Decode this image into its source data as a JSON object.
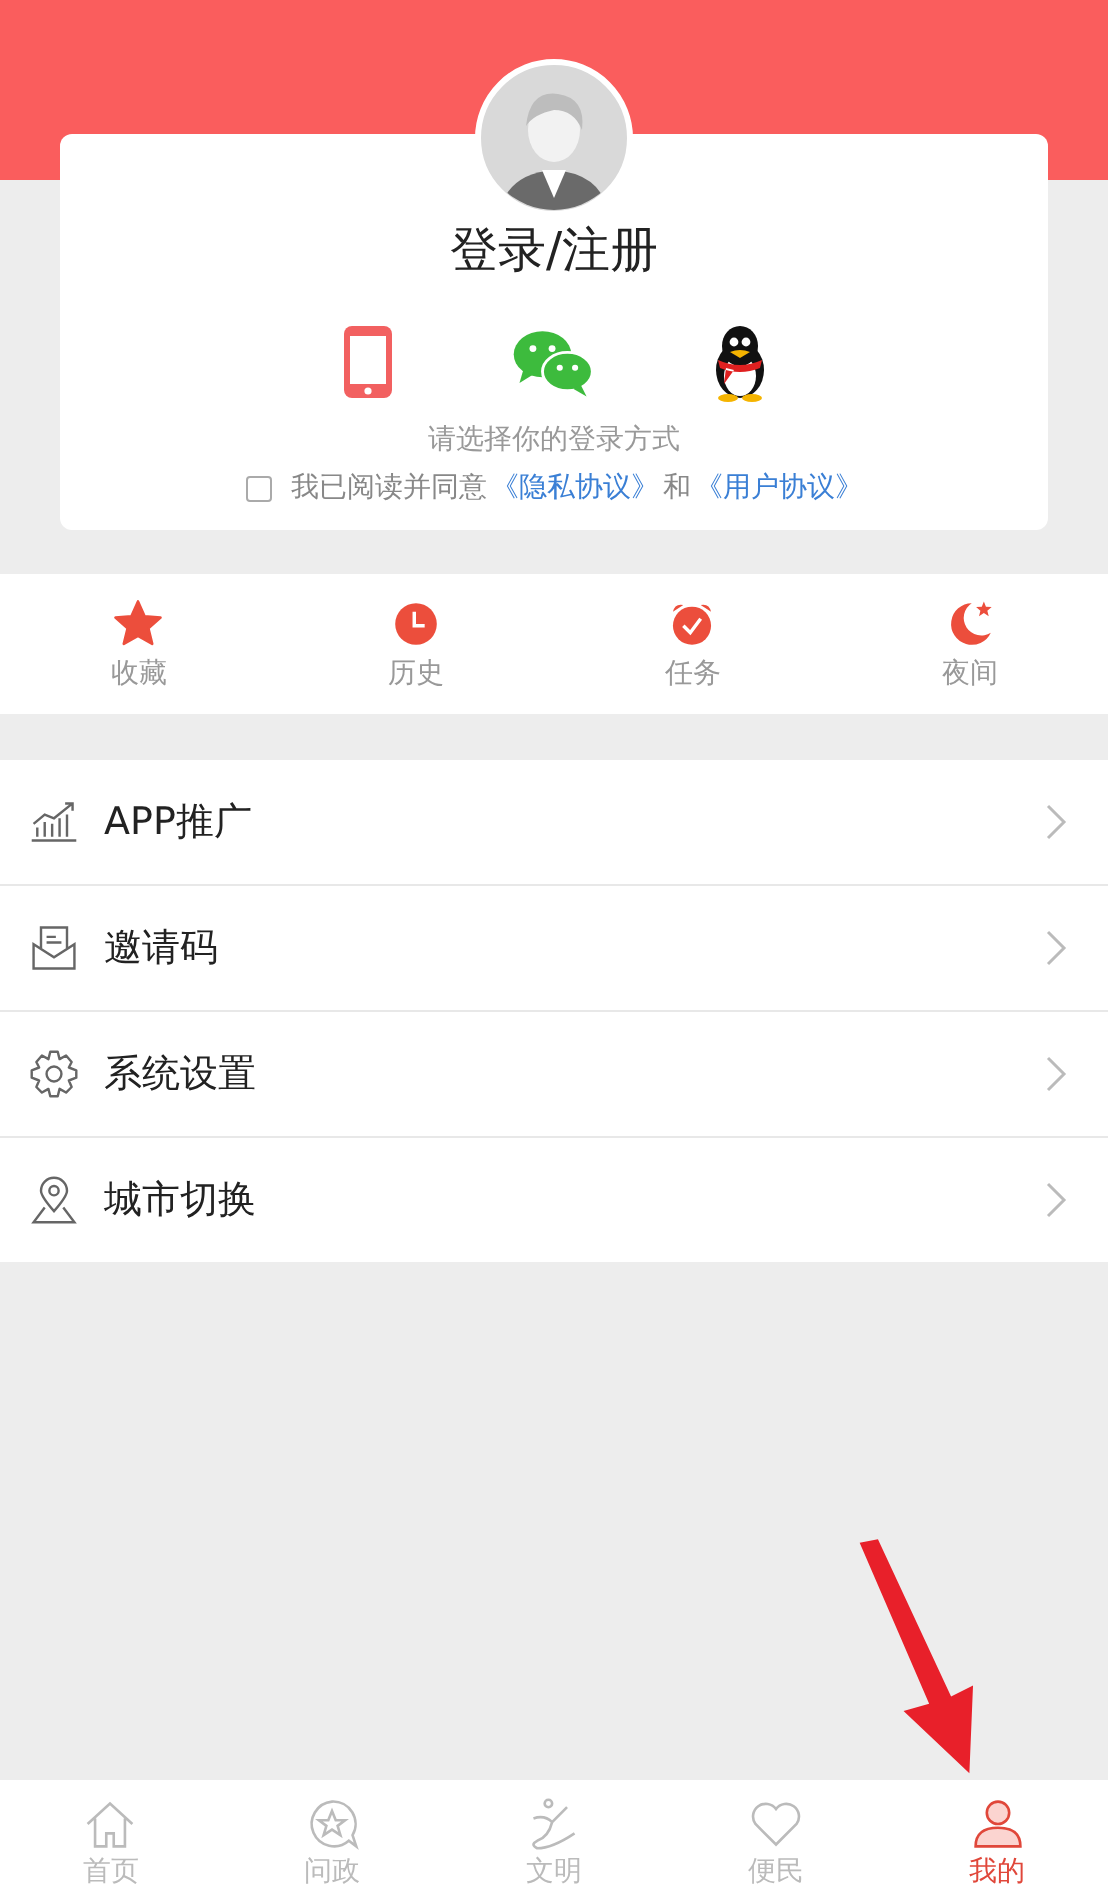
{
  "login": {
    "title": "登录/注册",
    "methods": [
      {
        "kind": "phone"
      },
      {
        "kind": "wechat"
      },
      {
        "kind": "qq"
      }
    ],
    "hint": "请选择你的登录方式",
    "agreement": {
      "checked": false,
      "prefix": "我已阅读并同意",
      "privacy_link": "《隐私协议》",
      "joiner": "和",
      "user_link": "《用户协议》"
    }
  },
  "quick_actions": [
    {
      "kind": "star",
      "label": "收藏"
    },
    {
      "kind": "clock",
      "label": "历史"
    },
    {
      "kind": "alarm",
      "label": "任务"
    },
    {
      "kind": "moon",
      "label": "夜间"
    }
  ],
  "menu": [
    {
      "kind": "chart",
      "label": "APP推广"
    },
    {
      "kind": "mail",
      "label": "邀请码"
    },
    {
      "kind": "gear",
      "label": "系统设置"
    },
    {
      "kind": "pin",
      "label": "城市切换"
    }
  ],
  "tab_bar": [
    {
      "kind": "home",
      "label": "首页",
      "selected": false
    },
    {
      "kind": "chat",
      "label": "问政",
      "selected": false
    },
    {
      "kind": "figure",
      "label": "文明",
      "selected": false
    },
    {
      "kind": "heart",
      "label": "便民",
      "selected": false
    },
    {
      "kind": "person",
      "label": "我的",
      "selected": true
    }
  ]
}
